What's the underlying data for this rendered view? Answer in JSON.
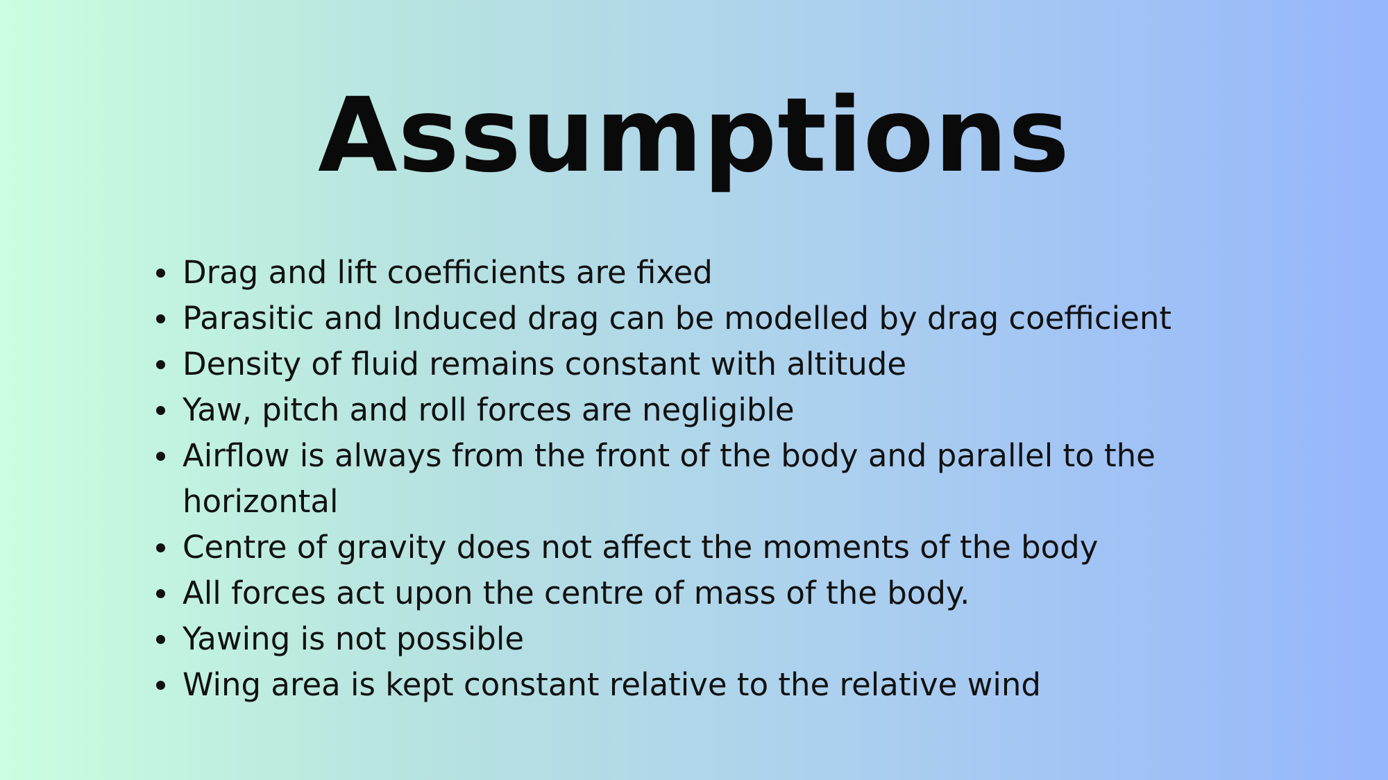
{
  "slide": {
    "title": "Assumptions",
    "bullets": [
      "Drag and lift coefficients are fixed",
      "Parasitic and Induced drag can be modelled by drag coefficient",
      "Density of fluid remains constant with altitude",
      "Yaw, pitch and roll forces are negligible",
      "Airflow is always from the front of the body and parallel to the horizontal",
      "Centre of gravity does not affect the moments of the body",
      "All forces act upon the centre of mass of the body.",
      "Yawing is not possible",
      "Wing area is kept constant relative to the relative wind"
    ]
  },
  "colors": {
    "gradient_left": "#cafee0",
    "gradient_right": "#96b6fc",
    "text": "#111111"
  }
}
